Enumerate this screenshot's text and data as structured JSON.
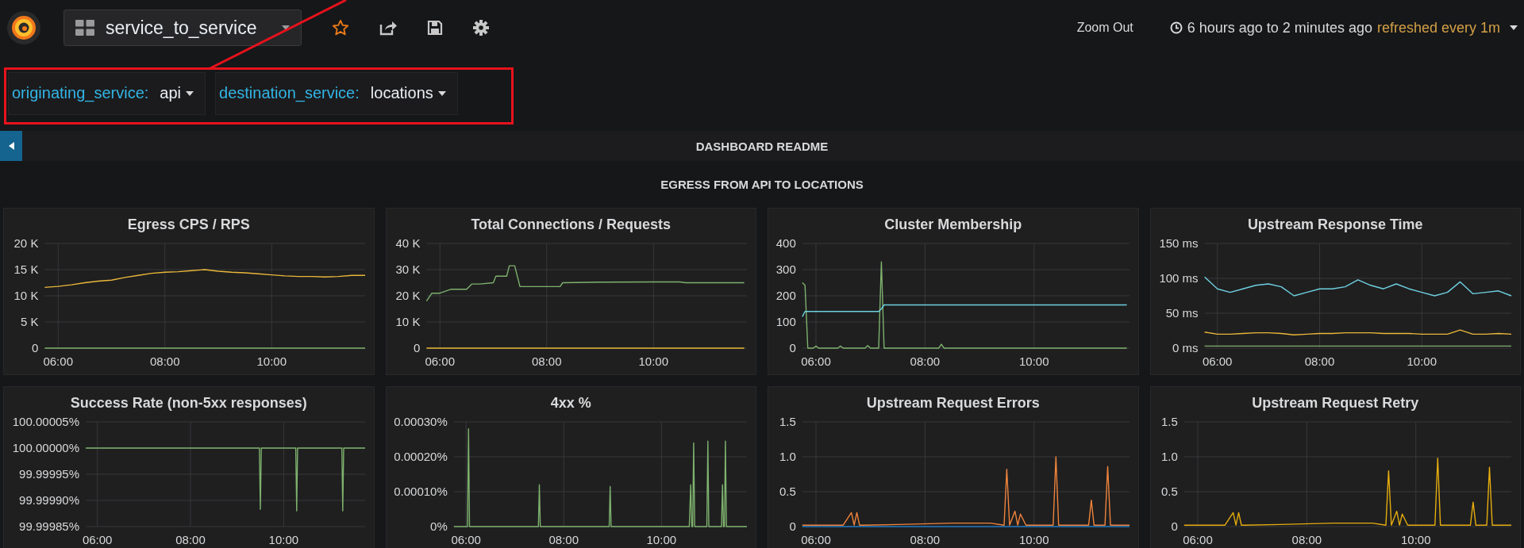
{
  "top_bar": {
    "dashboard_title": "service_to_service",
    "zoom_out": "Zoom Out",
    "time_range": "6 hours ago to 2 minutes ago",
    "refresh": "refreshed every 1m"
  },
  "variables": [
    {
      "label": "originating_service:",
      "value": "api"
    },
    {
      "label": "destination_service:",
      "value": "locations"
    }
  ],
  "readme_row": {
    "title": "DASHBOARD README"
  },
  "section_title": "EGRESS FROM API TO LOCATIONS",
  "panels": [
    {
      "title": "Egress CPS / RPS",
      "chart_data": {
        "type": "line",
        "grid": true,
        "x": [
          5.75,
          6,
          6.25,
          6.5,
          6.75,
          7,
          7.25,
          7.5,
          7.75,
          8,
          8.25,
          8.5,
          8.75,
          9,
          9.25,
          9.5,
          9.75,
          10,
          10.25,
          10.5,
          10.75,
          11,
          11.25,
          11.5,
          11.75
        ],
        "xlim": [
          5.75,
          11.75
        ],
        "ylim": [
          0,
          20000
        ],
        "xticks": [
          {
            "value": 6,
            "label": "06:00"
          },
          {
            "value": 8,
            "label": "08:00"
          },
          {
            "value": 10,
            "label": "10:00"
          }
        ],
        "yticks": [
          {
            "value": 0,
            "label": "0"
          },
          {
            "value": 5000,
            "label": "5 K"
          },
          {
            "value": 10000,
            "label": "10 K"
          },
          {
            "value": 15000,
            "label": "15 K"
          },
          {
            "value": 20000,
            "label": "20 K"
          }
        ],
        "series": [
          {
            "color": "#eab839",
            "values": [
              11600,
              11800,
              12100,
              12500,
              12800,
              13000,
              13500,
              13900,
              14300,
              14500,
              14600,
              14800,
              15000,
              14700,
              14500,
              14400,
              14200,
              14000,
              13800,
              13700,
              13700,
              13600,
              13700,
              13900,
              13900
            ]
          },
          {
            "color": "#7eb26d",
            "values": [
              0,
              0,
              0,
              0,
              0,
              0,
              0,
              0,
              0,
              0,
              0,
              0,
              0,
              0,
              0,
              0,
              0,
              0,
              0,
              0,
              0,
              0,
              0,
              0,
              0
            ]
          }
        ]
      }
    },
    {
      "title": "Total Connections / Requests",
      "chart_data": {
        "type": "line",
        "grid": true,
        "x": [
          5.75,
          5.85,
          6,
          6.2,
          6.5,
          6.6,
          6.75,
          7,
          7.05,
          7.25,
          7.3,
          7.4,
          7.5,
          8.25,
          8.3,
          9,
          10,
          10.5,
          10.6,
          11.7
        ],
        "xlim": [
          5.75,
          11.75
        ],
        "ylim": [
          0,
          40000
        ],
        "xticks": [
          {
            "value": 6,
            "label": "06:00"
          },
          {
            "value": 8,
            "label": "08:00"
          },
          {
            "value": 10,
            "label": "10:00"
          }
        ],
        "yticks": [
          {
            "value": 0,
            "label": "0"
          },
          {
            "value": 10000,
            "label": "10 K"
          },
          {
            "value": 20000,
            "label": "20 K"
          },
          {
            "value": 30000,
            "label": "30 K"
          },
          {
            "value": 40000,
            "label": "40 K"
          }
        ],
        "series": [
          {
            "color": "#7eb26d",
            "values": [
              18000,
              21000,
              21000,
              22500,
              22500,
              24500,
              24500,
              25000,
              27500,
              27500,
              31500,
              31500,
              23500,
              23500,
              25000,
              25200,
              25300,
              25300,
              25000,
              25000
            ]
          },
          {
            "color": "#eab839",
            "values": [
              0,
              0,
              0,
              0,
              0,
              0,
              0,
              0,
              0,
              0,
              0,
              0,
              0,
              0,
              0,
              0,
              0,
              0,
              0,
              0
            ]
          }
        ]
      }
    },
    {
      "title": "Cluster Membership",
      "chart_data": {
        "type": "line",
        "grid": true,
        "x": [
          5.75,
          5.8,
          5.85,
          5.95,
          6,
          6.05,
          6.4,
          6.45,
          6.5,
          6.9,
          6.95,
          7,
          7.15,
          7.2,
          7.25,
          7.3,
          8.25,
          8.3,
          8.35,
          11.7
        ],
        "xlim": [
          5.75,
          11.75
        ],
        "ylim": [
          0,
          400
        ],
        "xticks": [
          {
            "value": 6,
            "label": "06:00"
          },
          {
            "value": 8,
            "label": "08:00"
          },
          {
            "value": 10,
            "label": "10:00"
          }
        ],
        "yticks": [
          0,
          100,
          200,
          300,
          400
        ],
        "series": [
          {
            "color": "#7eb26d",
            "values": [
              250,
              240,
              0,
              0,
              8,
              0,
              0,
              8,
              0,
              0,
              10,
              0,
              0,
              330,
              0,
              0,
              0,
              15,
              0,
              0
            ]
          },
          {
            "color": "#6ed0e0",
            "values": [
              120,
              140,
              140,
              140,
              140,
              140,
              140,
              140,
              140,
              140,
              140,
              140,
              140,
              150,
              165,
              165,
              165,
              165,
              165,
              165
            ]
          }
        ]
      }
    },
    {
      "title": "Upstream Response Time",
      "chart_data": {
        "type": "line",
        "grid": true,
        "x": [
          5.75,
          6,
          6.25,
          6.5,
          6.75,
          7,
          7.25,
          7.5,
          7.75,
          8,
          8.25,
          8.5,
          8.75,
          9,
          9.25,
          9.5,
          9.75,
          10,
          10.25,
          10.5,
          10.75,
          11,
          11.25,
          11.5,
          11.75
        ],
        "xlim": [
          5.75,
          11.75
        ],
        "ylim": [
          0,
          150
        ],
        "xticks": [
          {
            "value": 6,
            "label": "06:00"
          },
          {
            "value": 8,
            "label": "08:00"
          },
          {
            "value": 10,
            "label": "10:00"
          }
        ],
        "yticks": [
          {
            "value": 0,
            "label": "0 ms"
          },
          {
            "value": 50,
            "label": "50 ms"
          },
          {
            "value": 100,
            "label": "100 ms"
          },
          {
            "value": 150,
            "label": "150 ms"
          }
        ],
        "series": [
          {
            "color": "#6ed0e0",
            "values": [
              102,
              85,
              80,
              85,
              90,
              92,
              88,
              75,
              80,
              85,
              85,
              88,
              98,
              90,
              85,
              92,
              85,
              80,
              75,
              80,
              95,
              78,
              80,
              82,
              75
            ]
          },
          {
            "color": "#eab839",
            "values": [
              23,
              20,
              20,
              21,
              22,
              22,
              21,
              19,
              20,
              21,
              21,
              22,
              22,
              22,
              21,
              21,
              21,
              20,
              20,
              20,
              26,
              20,
              20,
              21,
              20
            ]
          },
          {
            "color": "#7eb26d",
            "values": [
              3,
              3,
              3,
              3,
              3,
              3,
              3,
              3,
              3,
              3,
              3,
              3,
              3,
              3,
              3,
              3,
              3,
              3,
              3,
              3,
              3,
              3,
              3,
              3,
              3
            ]
          }
        ]
      }
    },
    {
      "title": "Success Rate (non-5xx responses)",
      "chart_data": {
        "type": "line",
        "grid": true,
        "x": [
          5.75,
          9.48,
          9.5,
          9.52,
          10.26,
          10.28,
          10.3,
          11.25,
          11.27,
          11.29,
          11.75
        ],
        "xlim": [
          5.75,
          11.75
        ],
        "ylim": [
          99.99985,
          100.00005
        ],
        "xticks": [
          {
            "value": 6,
            "label": "06:00"
          },
          {
            "value": 8,
            "label": "08:00"
          },
          {
            "value": 10,
            "label": "10:00"
          }
        ],
        "yticks": [
          {
            "value": 99.99985,
            "label": "99.99985%"
          },
          {
            "value": 99.9999,
            "label": "99.99990%"
          },
          {
            "value": 99.99995,
            "label": "99.99995%"
          },
          {
            "value": 100,
            "label": "100.00000%"
          },
          {
            "value": 100.00005,
            "label": "100.00005%"
          }
        ],
        "series": [
          {
            "color": "#7eb26d",
            "values": [
              100,
              100,
              99.999883,
              100,
              100,
              99.99988,
              100,
              100,
              99.99988,
              100,
              100
            ]
          }
        ]
      }
    },
    {
      "title": "4xx %",
      "chart_data": {
        "type": "line",
        "grid": true,
        "x": [
          5.75,
          6.03,
          6.05,
          6.07,
          7.48,
          7.5,
          7.52,
          8.93,
          8.95,
          8.97,
          10.57,
          10.6,
          10.62,
          10.64,
          10.66,
          10.68,
          10.93,
          10.95,
          10.97,
          11.23,
          11.25,
          11.27,
          11.29,
          11.31,
          11.33,
          11.75
        ],
        "xlim": [
          5.75,
          11.75
        ],
        "ylim": [
          0,
          0.0003
        ],
        "xticks": [
          {
            "value": 6,
            "label": "06:00"
          },
          {
            "value": 8,
            "label": "08:00"
          },
          {
            "value": 10,
            "label": "10:00"
          }
        ],
        "yticks": [
          {
            "value": 0,
            "label": "0%"
          },
          {
            "value": 0.0001,
            "label": "0.00010%"
          },
          {
            "value": 0.0002,
            "label": "0.00020%"
          },
          {
            "value": 0.0003,
            "label": "0.00030%"
          }
        ],
        "series": [
          {
            "color": "#7eb26d",
            "values": [
              0,
              0,
              0.00028,
              0,
              0,
              0.00012,
              0,
              0,
              0.000115,
              0,
              0,
              0.00012,
              0,
              0,
              0.00024,
              0,
              0,
              0.000245,
              0,
              0,
              0.00012,
              0,
              0,
              0.000245,
              0,
              0
            ]
          }
        ]
      }
    },
    {
      "title": "Upstream Request Errors",
      "chart_data": {
        "type": "line",
        "grid": true,
        "x": [
          5.75,
          6.5,
          6.65,
          6.7,
          6.75,
          6.8,
          6.85,
          7.5,
          8.5,
          9.2,
          9.45,
          9.5,
          9.55,
          9.65,
          9.7,
          9.75,
          9.85,
          9.9,
          9.95,
          10.35,
          10.4,
          10.45,
          11,
          11.05,
          11.1,
          11.15,
          11.3,
          11.35,
          11.4,
          11.75
        ],
        "xlim": [
          5.75,
          11.75
        ],
        "ylim": [
          0,
          1.5
        ],
        "xticks": [
          {
            "value": 6,
            "label": "06:00"
          },
          {
            "value": 8,
            "label": "08:00"
          },
          {
            "value": 10,
            "label": "10:00"
          }
        ],
        "yticks": [
          {
            "value": 0,
            "label": "0"
          },
          {
            "value": 0.5,
            "label": "0.5"
          },
          {
            "value": 1,
            "label": "1.0"
          },
          {
            "value": 1.5,
            "label": "1.5"
          }
        ],
        "series": [
          {
            "color": "#ef843c",
            "values": [
              0.02,
              0.02,
              0.2,
              0.02,
              0.2,
              0.02,
              0.02,
              0.03,
              0.05,
              0.05,
              0.02,
              0.82,
              0.02,
              0.22,
              0.02,
              0.18,
              0.02,
              0.02,
              0.02,
              0.02,
              1.0,
              0.02,
              0.02,
              0.38,
              0.02,
              0.02,
              0.02,
              0.86,
              0.02,
              0.02
            ]
          },
          {
            "color": "#1f78c1",
            "values": [
              0,
              0,
              0,
              0,
              0,
              0,
              0,
              0,
              0,
              0,
              0,
              0,
              0,
              0,
              0,
              0,
              0,
              0,
              0,
              0,
              0,
              0,
              0,
              0,
              0,
              0,
              0,
              0,
              0,
              0
            ]
          }
        ]
      }
    },
    {
      "title": "Upstream Request Retry",
      "chart_data": {
        "type": "line",
        "grid": true,
        "x": [
          5.75,
          6.5,
          6.65,
          6.7,
          6.75,
          6.8,
          6.85,
          7.5,
          8.5,
          9.2,
          9.45,
          9.5,
          9.55,
          9.65,
          9.7,
          9.75,
          9.85,
          9.9,
          9.95,
          10.35,
          10.4,
          10.45,
          11,
          11.05,
          11.1,
          11.15,
          11.3,
          11.35,
          11.4,
          11.75
        ],
        "xlim": [
          5.75,
          11.75
        ],
        "ylim": [
          0,
          1.5
        ],
        "xticks": [
          {
            "value": 6,
            "label": "06:00"
          },
          {
            "value": 8,
            "label": "08:00"
          },
          {
            "value": 10,
            "label": "10:00"
          }
        ],
        "yticks": [
          {
            "value": 0,
            "label": "0"
          },
          {
            "value": 0.5,
            "label": "0.5"
          },
          {
            "value": 1,
            "label": "1.0"
          },
          {
            "value": 1.5,
            "label": "1.5"
          }
        ],
        "series": [
          {
            "color": "#e5ac0e",
            "values": [
              0.02,
              0.02,
              0.2,
              0.02,
              0.2,
              0.02,
              0.02,
              0.03,
              0.05,
              0.05,
              0.02,
              0.8,
              0.02,
              0.22,
              0.02,
              0.18,
              0.02,
              0.02,
              0.02,
              0.02,
              0.98,
              0.02,
              0.02,
              0.35,
              0.02,
              0.02,
              0.02,
              0.85,
              0.02,
              0.02
            ]
          }
        ]
      }
    }
  ]
}
